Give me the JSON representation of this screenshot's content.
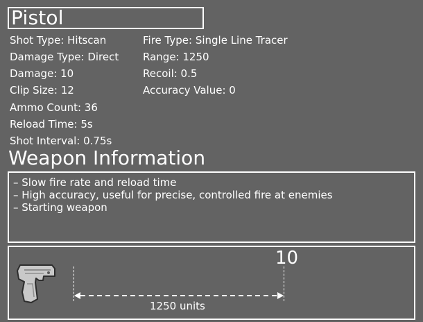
{
  "weapon": {
    "name": "Pistol"
  },
  "stats_left": [
    "Shot Type: Hitscan",
    "Damage Type: Direct",
    "Damage: 10",
    "Clip Size: 12",
    "Ammo Count: 36",
    "Reload Time: 5s",
    "Shot Interval: 0.75s"
  ],
  "stats_right": [
    "Fire Type: Single Line Tracer",
    "Range: 1250",
    "Recoil: 0.5",
    "Accuracy Value: 0"
  ],
  "info": {
    "heading": "Weapon Information",
    "notes": [
      "– Slow fire rate and reload time",
      "– High accuracy, useful for precise, controlled fire at enemies",
      "– Starting weapon"
    ]
  },
  "range_display": {
    "value": "10",
    "label": "1250 units",
    "icon": "pistol-icon"
  }
}
